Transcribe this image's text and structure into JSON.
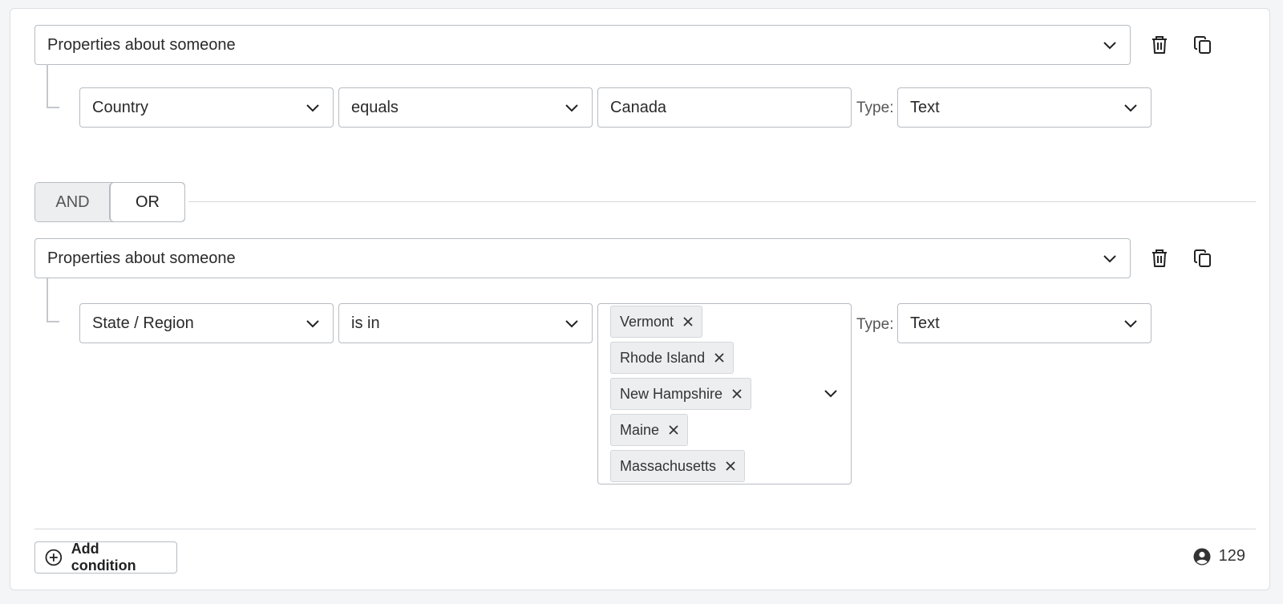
{
  "group1": {
    "source_select": "Properties about someone",
    "field_select": "Country",
    "operator_select": "equals",
    "value_input": "Canada",
    "type_label": "Type:",
    "type_select": "Text"
  },
  "logic_toggle": {
    "and_label": "AND",
    "or_label": "OR",
    "selected": "OR"
  },
  "group2": {
    "source_select": "Properties about someone",
    "field_select": "State / Region",
    "operator_select": "is in",
    "values": [
      "Vermont",
      "Rhode Island",
      "New Hampshire",
      "Maine",
      "Massachusetts"
    ],
    "type_label": "Type:",
    "type_select": "Text"
  },
  "footer": {
    "add_condition_label": "Add condition",
    "audience_count": "129"
  },
  "icons": {
    "delete": "trash-icon",
    "duplicate": "copy-icon",
    "dropdown": "chevron-down-icon",
    "remove_chip": "close-icon",
    "add": "plus-circle-icon",
    "audience": "user-circle-icon"
  }
}
